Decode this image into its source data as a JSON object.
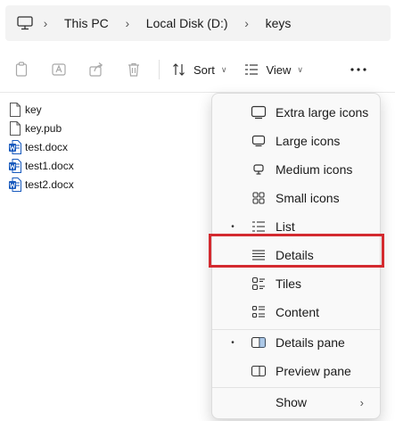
{
  "breadcrumb": [
    "This PC",
    "Local Disk (D:)",
    "keys"
  ],
  "toolbar": {
    "sort_label": "Sort",
    "view_label": "View",
    "icons": [
      "copy-icon",
      "rename-icon",
      "share-icon",
      "delete-icon",
      "sort-icon",
      "view-icon",
      "more-icon"
    ]
  },
  "files": [
    {
      "name": "key",
      "type": "generic"
    },
    {
      "name": "key.pub",
      "type": "generic"
    },
    {
      "name": "test.docx",
      "type": "word"
    },
    {
      "name": "test1.docx",
      "type": "word"
    },
    {
      "name": "test2.docx",
      "type": "word"
    }
  ],
  "view_menu": {
    "items": [
      {
        "label": "Extra large icons",
        "icon": "monitor-icon",
        "selected": false
      },
      {
        "label": "Large icons",
        "icon": "monitor-icon",
        "selected": false
      },
      {
        "label": "Medium icons",
        "icon": "monitor-small-icon",
        "selected": false
      },
      {
        "label": "Small icons",
        "icon": "small-grid-icon",
        "selected": false
      },
      {
        "label": "List",
        "icon": "list-icon",
        "selected": true
      },
      {
        "label": "Details",
        "icon": "details-icon",
        "selected": false
      },
      {
        "label": "Tiles",
        "icon": "tiles-icon",
        "selected": false
      },
      {
        "label": "Content",
        "icon": "content-icon",
        "selected": false
      }
    ],
    "pane_items": [
      {
        "label": "Details pane",
        "icon": "details-pane-icon",
        "selected": true
      },
      {
        "label": "Preview pane",
        "icon": "preview-pane-icon",
        "selected": false
      }
    ],
    "show_label": "Show",
    "bullet": "•",
    "arrow": "›"
  },
  "colors": {
    "highlight": "#d42a2f",
    "word_blue": "#185abd",
    "disabled_icon": "#a8a8a8"
  }
}
